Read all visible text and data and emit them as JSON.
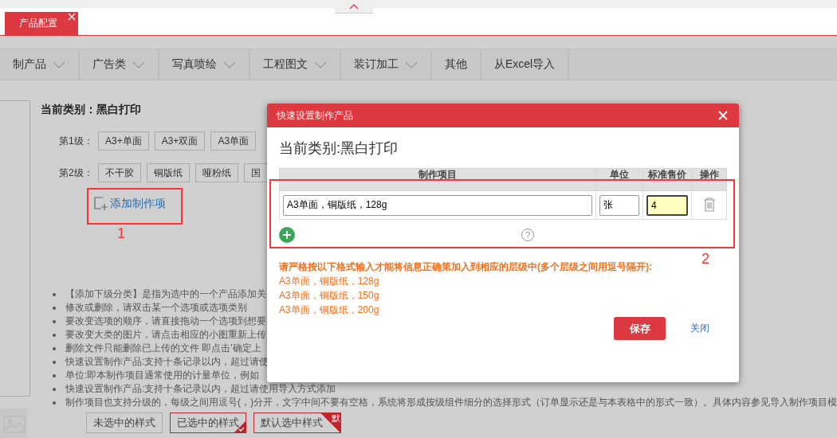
{
  "top_bar": {
    "tabs": [
      {
        "label": "产品配置",
        "selected": true
      }
    ]
  },
  "category_nav": {
    "items": [
      {
        "label": "制产品",
        "dropdown": true
      },
      {
        "label": "广告类",
        "dropdown": true
      },
      {
        "label": "写真喷绘",
        "dropdown": true
      },
      {
        "label": "工程图文",
        "dropdown": true
      },
      {
        "label": "装订加工",
        "dropdown": true
      },
      {
        "label": "其他",
        "dropdown": false
      },
      {
        "label": "从Excel导入",
        "dropdown": false
      }
    ]
  },
  "category_panel": {
    "title": "当前类别：黑白打印",
    "levels": [
      {
        "label": "第1级：",
        "options": [
          "A3+单面",
          "A3+双面",
          "A3单面"
        ]
      },
      {
        "label": "第2级：",
        "options": [
          "不干胶",
          "铜版纸",
          "哑粉纸",
          "国"
        ]
      }
    ],
    "add_link": "添加制作项",
    "notes": [
      "【添加下级分类】是指为选中的一个产品添加关",
      "修改或删除，请双击某一个选项或选项类别",
      "要改变选项的顺序，请直接拖动一个选项到想要",
      "要改变大类的图片，请点击相应的小图重新上传",
      "删除文件只能删除已上传的文件 即点击'确定上",
      "快速设置制作产品:支持十条记录以内，超过请使",
      "单位:即本制作项目通常使用的计量单位，例如",
      "快速设置制作产品:支持十条记录以内，超过请使用导入方式添加",
      "制作项目也支持分级的，每级之间用逗号(，)分开，文字中间不要有空格，系统将形成按级组件细分的选择形式（订单显示还是与本表格中的形式一致）。具体内容参见导入制作项目模"
    ],
    "style_samples": [
      {
        "label": "未选中的样式",
        "kind": "unselected"
      },
      {
        "label": "已选中的样式",
        "kind": "selected"
      },
      {
        "label": "默认选中样式",
        "kind": "default",
        "corner": "默"
      }
    ]
  },
  "dialog": {
    "title": "快速设置制作产品",
    "heading": "当前类别:黑白打印",
    "table": {
      "columns": [
        "制作项目",
        "单位",
        "标准售价",
        "操作"
      ],
      "rows": [
        {
          "item": "A3单面，铜版纸，128g",
          "unit": "张",
          "price": "4",
          "focused": true
        }
      ]
    },
    "help_icon": "?",
    "hint_lines": [
      "请严格按以下格式输入才能将信息正确第加入到相应的层级中(多个层级之间用逗号隔开):",
      "A3单面，铜版纸，128g",
      "A3单面，铜版纸，150g",
      "A3单面，铜版纸，200g"
    ],
    "buttons": [
      {
        "label": "保存",
        "kind": "primary"
      },
      {
        "label": "关闭",
        "kind": "link"
      }
    ]
  },
  "annotations": [
    {
      "label": "1"
    },
    {
      "label": "2"
    }
  ]
}
